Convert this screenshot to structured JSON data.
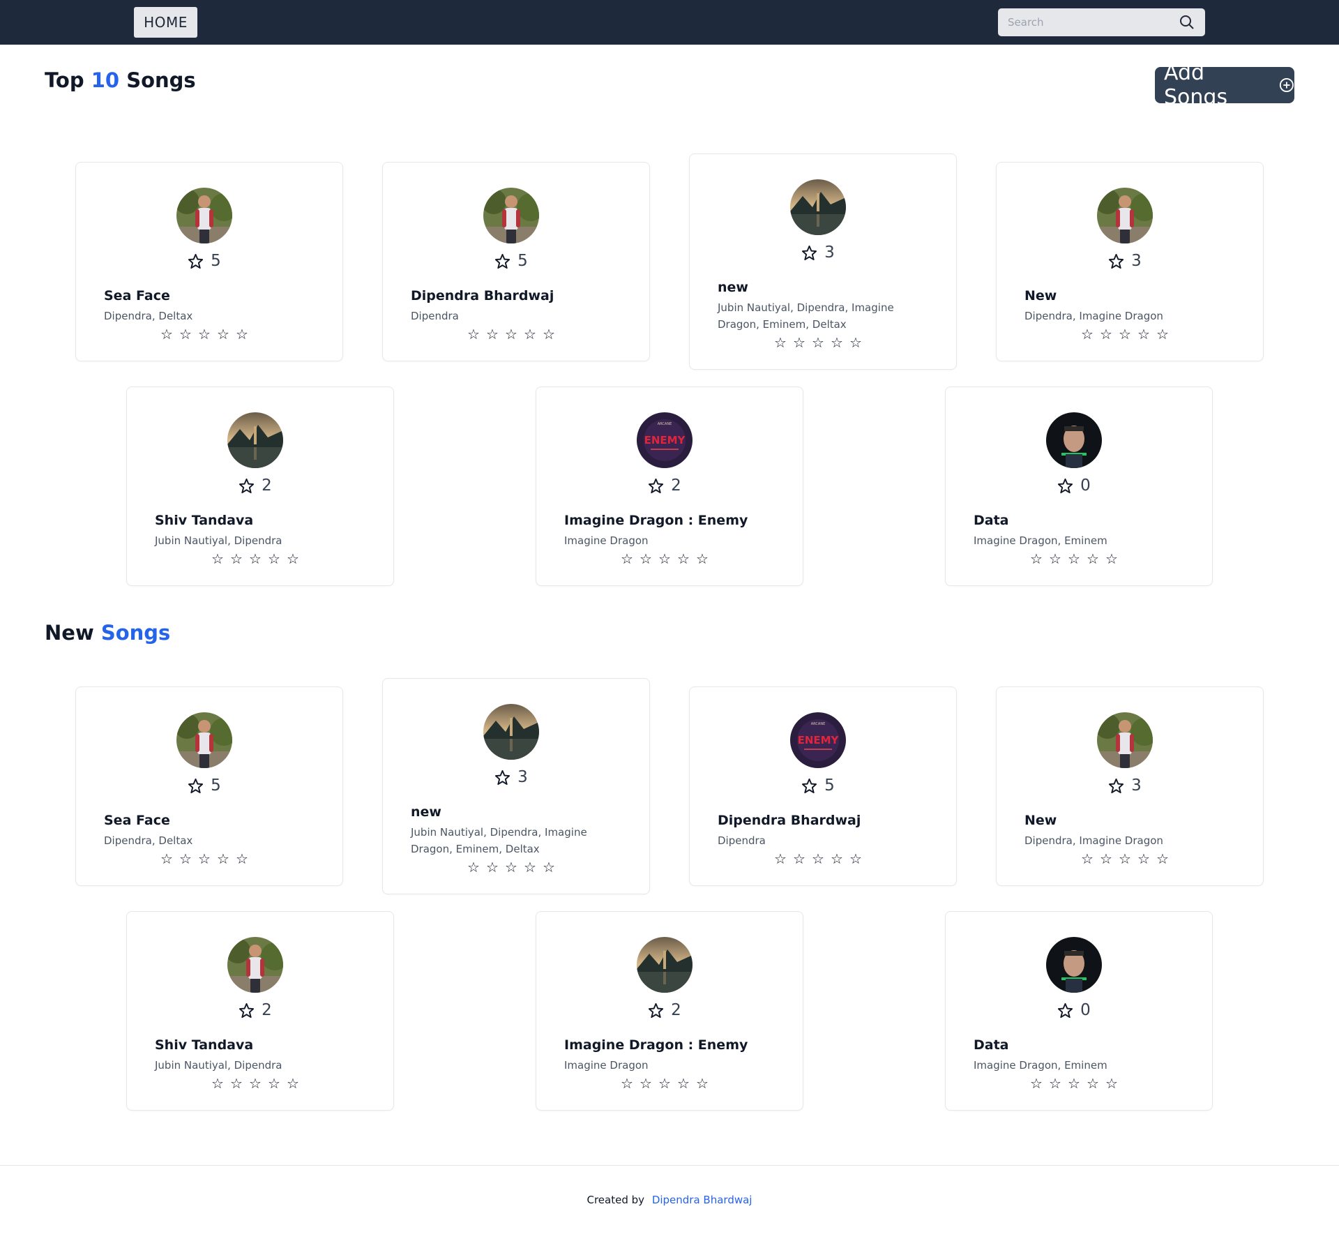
{
  "nav": {
    "home_label": "HOME",
    "search_placeholder": "Search"
  },
  "top_section": {
    "prefix": "Top",
    "accent": "10",
    "suffix": "Songs",
    "add_button_label": "Add Songs"
  },
  "new_section": {
    "prefix": "New",
    "accent": "Songs"
  },
  "top_songs": [
    {
      "title": "Sea Face",
      "artists": "Dipendra, Deltax",
      "rating": "5",
      "cover": "person"
    },
    {
      "title": "Dipendra Bhardwaj",
      "artists": "Dipendra",
      "rating": "5",
      "cover": "person"
    },
    {
      "title": "new",
      "artists": "Jubin Nautiyal, Dipendra, Imagine Dragon, Eminem, Deltax",
      "rating": "3",
      "cover": "landscape"
    },
    {
      "title": "New",
      "artists": "Dipendra, Imagine Dragon",
      "rating": "3",
      "cover": "person"
    },
    {
      "title": "Shiv Tandava",
      "artists": "Jubin Nautiyal, Dipendra",
      "rating": "2",
      "cover": "landscape"
    },
    {
      "title": "Imagine Dragon : Enemy",
      "artists": "Imagine Dragon",
      "rating": "2",
      "cover": "enemy"
    },
    {
      "title": "Data",
      "artists": "Imagine Dragon, Eminem",
      "rating": "0",
      "cover": "face"
    }
  ],
  "new_songs": [
    {
      "title": "Sea Face",
      "artists": "Dipendra, Deltax",
      "rating": "5",
      "cover": "person"
    },
    {
      "title": "new",
      "artists": "Jubin Nautiyal, Dipendra, Imagine Dragon, Eminem, Deltax",
      "rating": "3",
      "cover": "landscape"
    },
    {
      "title": "Dipendra Bhardwaj",
      "artists": "Dipendra",
      "rating": "5",
      "cover": "enemy"
    },
    {
      "title": "New",
      "artists": "Dipendra, Imagine Dragon",
      "rating": "3",
      "cover": "person"
    },
    {
      "title": "Shiv Tandava",
      "artists": "Jubin Nautiyal, Dipendra",
      "rating": "2",
      "cover": "person"
    },
    {
      "title": "Imagine Dragon : Enemy",
      "artists": "Imagine Dragon",
      "rating": "2",
      "cover": "landscape"
    },
    {
      "title": "Data",
      "artists": "Imagine Dragon, Eminem",
      "rating": "0",
      "cover": "face"
    }
  ],
  "empty_star": "☆",
  "footer": {
    "created_by": "Created by",
    "author": "Dipendra Bhardwaj"
  },
  "colors": {
    "navbar": "#1e293b",
    "accent": "#2563eb",
    "add_button": "#334155"
  }
}
